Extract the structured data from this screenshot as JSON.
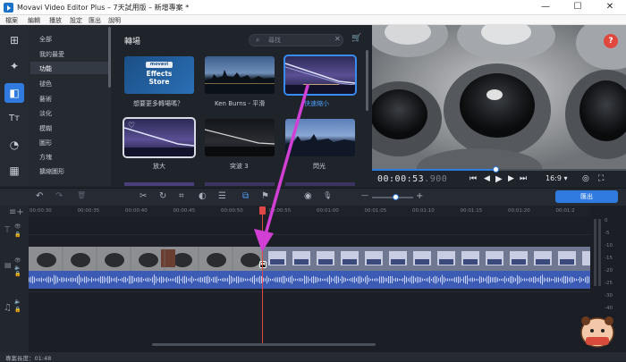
{
  "window": {
    "title": "Movavi Video Editor Plus – 7天試用版 – 新增專案 *",
    "minimize": "—",
    "maximize": "☐",
    "close": "✕"
  },
  "menu": [
    "檔案",
    "編輯",
    "播放",
    "設定",
    "匯出",
    "說明"
  ],
  "left_tools": [
    {
      "icon": "import-icon",
      "glyph": "⊞"
    },
    {
      "icon": "magic-wand-icon",
      "glyph": "✦"
    },
    {
      "icon": "transitions-icon",
      "glyph": "◧"
    },
    {
      "icon": "titles-icon",
      "glyph": "Tт"
    },
    {
      "icon": "stickers-icon",
      "glyph": "◔"
    },
    {
      "icon": "more-tools-icon",
      "glyph": "▦"
    }
  ],
  "categories": [
    "全部",
    "我的最愛",
    "功能",
    "褪色",
    "藝術",
    "淡化",
    "模糊",
    "圖形",
    "方塊",
    "擴縮圖形"
  ],
  "panel": {
    "title": "轉場",
    "search_placeholder": "尋找",
    "store_badge_top": "movavi",
    "store_badge_main": "Effects\nStore"
  },
  "transitions": [
    {
      "label": "想要更多轉場嗎？",
      "kind": "store"
    },
    {
      "label": "Ken Burns - 平滑",
      "kind": "city"
    },
    {
      "label": "快速縮小",
      "kind": "bridge",
      "selected": true
    },
    {
      "label": "放大",
      "kind": "bridge2",
      "favorite": true
    },
    {
      "label": "突波 3",
      "kind": "bridge3"
    },
    {
      "label": "閃光",
      "kind": "city2"
    }
  ],
  "preview": {
    "timecode_main": "00:00:53",
    "timecode_frac": ".900",
    "aspect": "16:9",
    "progress_fraction": 0.49,
    "help": "?"
  },
  "playback": {
    "skip_back": "⏮",
    "prev": "◀",
    "play": "▶",
    "next": "▶",
    "skip_fwd": "⏭",
    "snapshot": "◎",
    "fullscreen": "⛶",
    "aspect_caret": "▾"
  },
  "timeline_toolbar": {
    "undo": "↶",
    "redo": "↷",
    "delete": "🗑",
    "cut": "✂",
    "rotate": "↻",
    "crop": "⌗",
    "color": "◐",
    "list": "☰",
    "marker": "⚑",
    "snap": "⧉",
    "record_video": "◉",
    "record_audio": "🎙",
    "zoom_out": "—",
    "zoom_in": "+",
    "zoom_fraction": 0.5,
    "export_label": "匯出"
  },
  "ruler_ticks": [
    "00:00:30",
    "00:00:35",
    "00:00:40",
    "00:00:45",
    "00:00:50",
    "00:00:55",
    "00:01:00",
    "00:01:05",
    "00:01:10",
    "00:01:15",
    "00:01:20",
    "00:01:2"
  ],
  "meter_labels": [
    "0",
    "-5",
    "-10",
    "-15",
    "-20",
    "-25",
    "-30",
    "-40",
    "-50",
    "-60"
  ],
  "status": {
    "project_length": "專案長度：01:48"
  },
  "colors": {
    "accent": "#2f7be0",
    "playhead": "#e04848",
    "annotation_arrow": "#d23fd4"
  }
}
